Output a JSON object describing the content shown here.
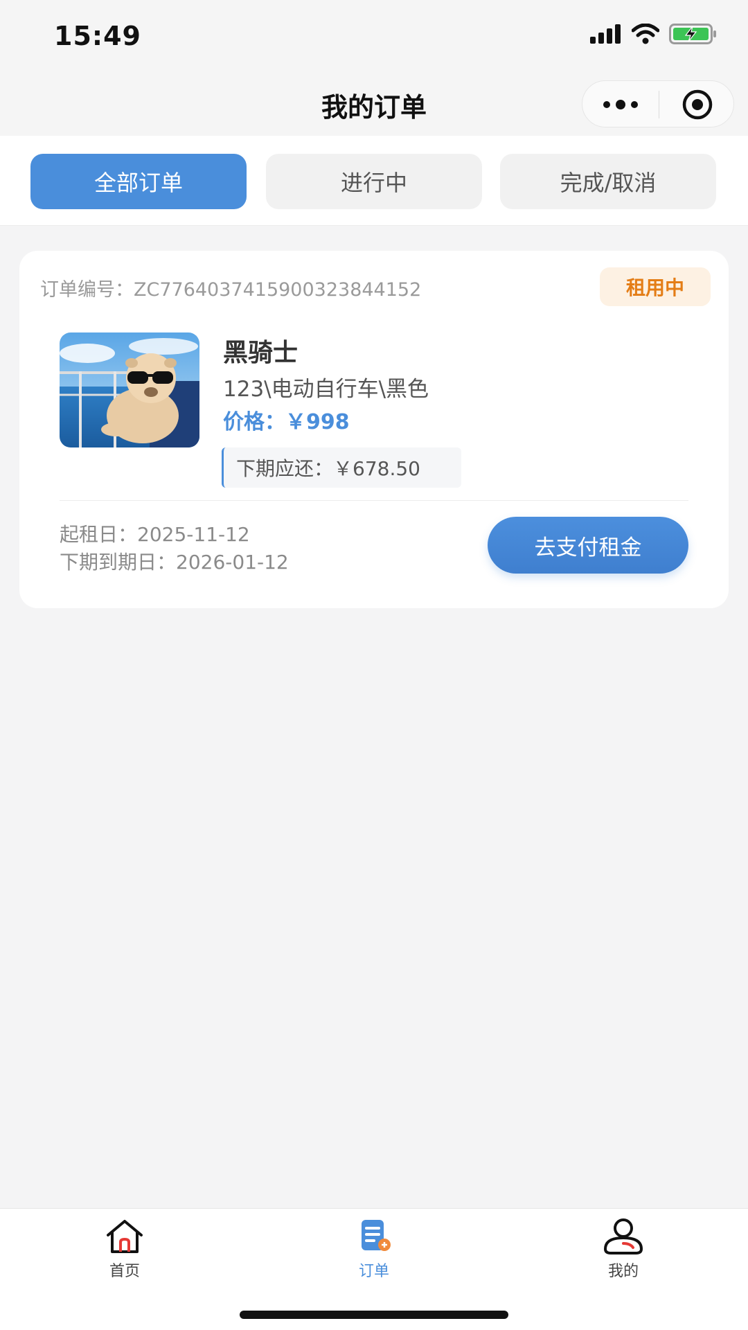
{
  "status_bar": {
    "time": "15:49",
    "icons": [
      "signal-icon",
      "wifi-icon",
      "battery-charging-icon"
    ]
  },
  "nav": {
    "title": "我的订单",
    "capsule": [
      "more-dots-icon",
      "close-target-icon"
    ]
  },
  "tabs": [
    {
      "label": "全部订单",
      "active": true
    },
    {
      "label": "进行中",
      "active": false
    },
    {
      "label": "完成/取消",
      "active": false
    }
  ],
  "order": {
    "number_label": "订单编号：",
    "number_value": "ZC776403741590032​3844152",
    "status": "租用中",
    "product": {
      "name": "黑骑士",
      "spec": "123\\电动自行车\\黑色",
      "price_label": "价格：",
      "price_value": "￥998"
    },
    "next_due_label": "下期应还：",
    "next_due_value": "￥678.50",
    "start_label": "起租日：",
    "start_value": "2025-11-12",
    "due_label": "下期到期日：",
    "due_value": "2026-01-12",
    "pay_button": "去支付租金"
  },
  "bottom_nav": [
    {
      "label": "首页",
      "icon": "home-icon",
      "active": false
    },
    {
      "label": "订单",
      "icon": "orders-icon",
      "active": true
    },
    {
      "label": "我的",
      "icon": "user-icon",
      "active": false
    }
  ],
  "colors": {
    "accent": "#4a8edb",
    "badge_text": "#e47d16",
    "badge_bg": "#fdf1e3",
    "page_bg": "#f4f4f5"
  }
}
